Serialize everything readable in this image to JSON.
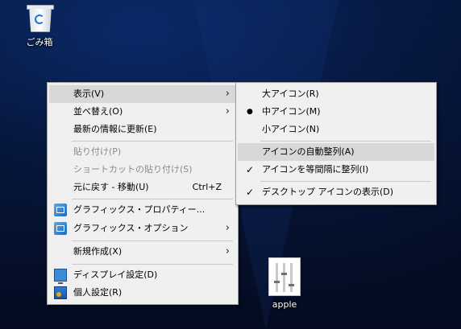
{
  "desktop": {
    "recycle_bin_label": "ごみ箱",
    "apple_label": "apple"
  },
  "context_menu": {
    "items": [
      {
        "label": "表示(V)"
      },
      {
        "label": "並べ替え(O)"
      },
      {
        "label": "最新の情報に更新(E)"
      },
      {
        "label": "貼り付け(P)"
      },
      {
        "label": "ショートカットの貼り付け(S)"
      },
      {
        "label": "元に戻す - 移動(U)",
        "shortcut": "Ctrl+Z"
      },
      {
        "label": "グラフィックス・プロパティー..."
      },
      {
        "label": "グラフィックス・オプション"
      },
      {
        "label": "新規作成(X)"
      },
      {
        "label": "ディスプレイ設定(D)"
      },
      {
        "label": "個人設定(R)"
      }
    ]
  },
  "view_submenu": {
    "items": [
      {
        "label": "大アイコン(R)"
      },
      {
        "label": "中アイコン(M)",
        "mark": "●"
      },
      {
        "label": "小アイコン(N)"
      },
      {
        "label": "アイコンの自動整列(A)"
      },
      {
        "label": "アイコンを等間隔に整列(I)",
        "mark": "✓"
      },
      {
        "label": "デスクトップ アイコンの表示(D)",
        "mark": "✓"
      }
    ]
  },
  "glyphs": {
    "submenu_arrow": "›"
  }
}
